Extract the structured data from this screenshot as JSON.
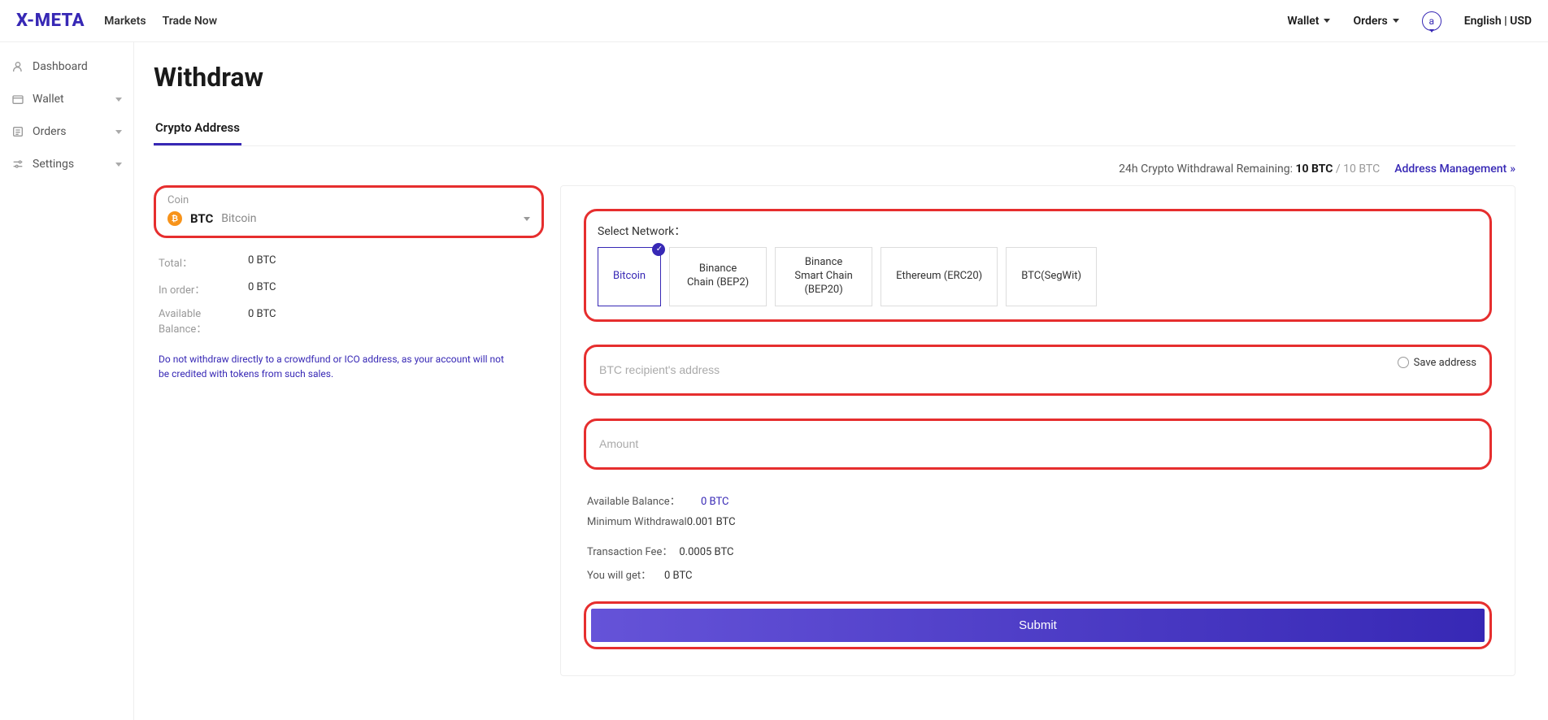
{
  "header": {
    "logo": "X-META",
    "nav": {
      "markets": "Markets",
      "trade_now": "Trade Now"
    },
    "wallet": "Wallet",
    "orders": "Orders",
    "avatar_letter": "a",
    "lang_curr": "English  |  USD"
  },
  "sidebar": {
    "dashboard": "Dashboard",
    "wallet": "Wallet",
    "orders": "Orders",
    "settings": "Settings"
  },
  "page": {
    "title": "Withdraw",
    "tab": "Crypto Address"
  },
  "coin": {
    "label": "Coin",
    "code": "BTC",
    "name": "Bitcoin"
  },
  "stats": {
    "total_label": "Total：",
    "total_value": "0 BTC",
    "in_order_label": "In order：",
    "in_order_value": "0 BTC",
    "avail_label": "Available Balance：",
    "avail_value": "0 BTC"
  },
  "note": "Do not withdraw directly to a crowdfund or ICO address, as your account will not be credited with tokens from such sales.",
  "limit": {
    "label": "24h Crypto Withdrawal Remaining: ",
    "bold": "10 BTC",
    "rest": " / 10 BTC"
  },
  "addr_mgmt": "Address Management",
  "network": {
    "label": "Select Network：",
    "options": [
      {
        "text": "Bitcoin",
        "selected": true
      },
      {
        "text": "Binance Chain (BEP2)",
        "selected": false
      },
      {
        "text": "Binance Smart Chain (BEP20)",
        "selected": false
      },
      {
        "text": "Ethereum (ERC20)",
        "selected": false
      },
      {
        "text": "BTC(SegWit)",
        "selected": false
      }
    ]
  },
  "address": {
    "placeholder": "BTC recipient's address",
    "save_label": "Save address"
  },
  "amount": {
    "placeholder": "Amount"
  },
  "details": {
    "avail_label": "Available Balance：",
    "avail_value": "0 BTC",
    "min_label": "Minimum Withdrawal ",
    "min_value": "0.001 BTC",
    "fee_label": "Transaction Fee：",
    "fee_value": "0.0005 BTC",
    "get_label": "You will get：",
    "get_value": "0 BTC"
  },
  "submit": "Submit"
}
